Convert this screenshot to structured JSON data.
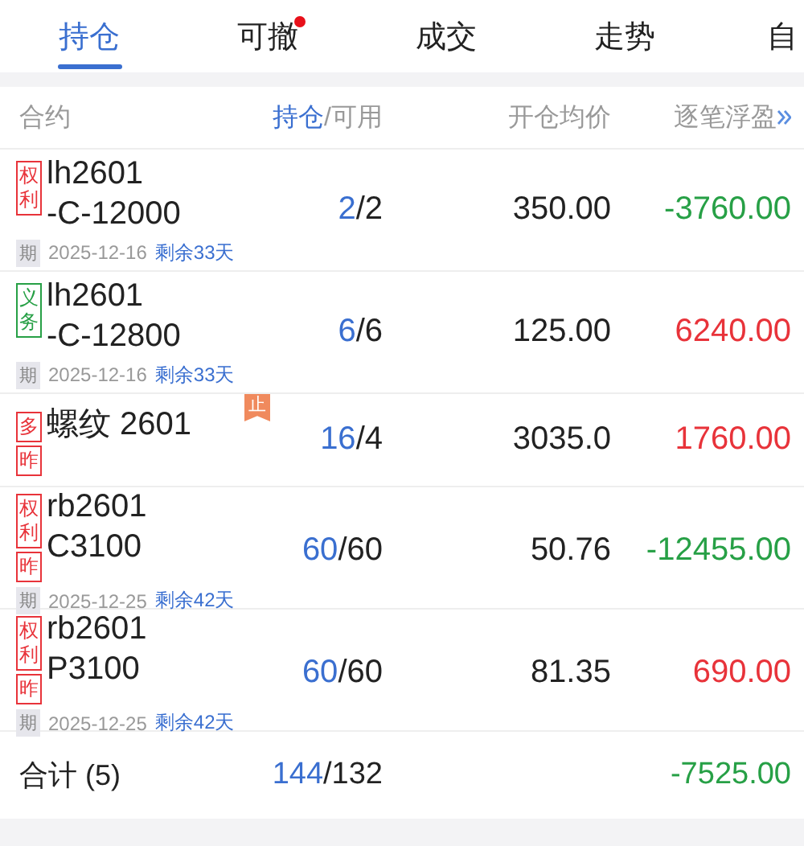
{
  "tabs": [
    {
      "label": "持仓",
      "selected": true,
      "dot": false
    },
    {
      "label": "可撤",
      "selected": false,
      "dot": true
    },
    {
      "label": "成交",
      "selected": false,
      "dot": false
    },
    {
      "label": "走势",
      "selected": false,
      "dot": false
    },
    {
      "label": "自",
      "selected": false,
      "dot": false
    }
  ],
  "columns": [
    {
      "label": "合约"
    },
    {
      "label": "持仓",
      "label_2": "/可用"
    },
    {
      "label": "开仓均价"
    },
    {
      "label": "逐笔浮盈"
    }
  ],
  "rows": [
    {
      "tags": [
        {
          "text": "权利",
          "color": "#e8333a"
        }
      ],
      "name": [
        "lh2601",
        "-C-12000"
      ],
      "stop": null,
      "expiry": {
        "badge": "期",
        "date": "2025-12-16",
        "remaining": "剩余33天"
      },
      "held": "2",
      "available": "/2",
      "avg_price": "350.00",
      "pnl": {
        "value": "-3760.00",
        "color": "#27a046"
      }
    },
    {
      "tags": [
        {
          "text": "义务",
          "color": "#27a046"
        }
      ],
      "name": [
        "lh2601",
        "-C-12800"
      ],
      "stop": null,
      "expiry": {
        "badge": "期",
        "date": "2025-12-16",
        "remaining": "剩余33天"
      },
      "held": "6",
      "available": "/6",
      "avg_price": "125.00",
      "pnl": {
        "value": "6240.00",
        "color": "#e8333a"
      }
    },
    {
      "tags": [
        {
          "text": "多",
          "color": "#e8333a"
        },
        {
          "text": "昨",
          "color": "#e8333a"
        }
      ],
      "name": [
        "螺纹 2601"
      ],
      "stop": "止",
      "expiry": null,
      "held": "16",
      "available": "/4",
      "avg_price": "3035.0",
      "pnl": {
        "value": "1760.00",
        "color": "#e8333a"
      }
    },
    {
      "tags": [
        {
          "text": "权利",
          "color": "#e8333a"
        },
        {
          "text": "昨",
          "color": "#e8333a"
        }
      ],
      "name": [
        "rb2601",
        "C3100"
      ],
      "stop": null,
      "expiry": {
        "badge": "期",
        "date": "2025-12-25",
        "remaining": "剩余42天"
      },
      "held": "60",
      "available": "/60",
      "avg_price": "50.76",
      "pnl": {
        "value": "-12455.00",
        "color": "#27a046"
      }
    },
    {
      "tags": [
        {
          "text": "权利",
          "color": "#e8333a"
        },
        {
          "text": "昨",
          "color": "#e8333a"
        }
      ],
      "name": [
        "rb2601",
        "P3100"
      ],
      "stop": null,
      "expiry": {
        "badge": "期",
        "date": "2025-12-25",
        "remaining": "剩余42天"
      },
      "held": "60",
      "available": "/60",
      "avg_price": "81.35",
      "pnl": {
        "value": "690.00",
        "color": "#e8333a"
      }
    }
  ],
  "total": {
    "label": "合计 (5)",
    "held": "144",
    "available": "/132",
    "pnl": {
      "value": "-7525.00",
      "color": "#27a046"
    }
  }
}
